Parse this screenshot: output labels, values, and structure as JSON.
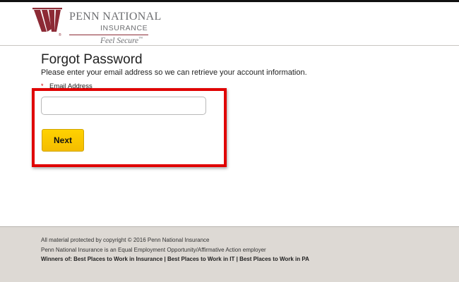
{
  "brand": {
    "name": "PENN NATIONAL",
    "sub": "INSURANCE",
    "tagline": "Feel Secure",
    "tagline_mark": "™",
    "registered_mark": "®",
    "accent_color": "#8c2a35"
  },
  "form": {
    "title": "Forgot Password",
    "instructions": "Please enter your email address so we can retrieve your account information.",
    "required_marker": "*",
    "email_label": "Email Address",
    "email_value": "",
    "email_placeholder": "",
    "next_label": "Next",
    "next_color": "#ffcc00"
  },
  "highlight_color": "#e00000",
  "footer": {
    "copyright": "All material protected by copyright © 2016 Penn National Insurance",
    "eeo": "Penn National Insurance is an Equal Employment Opportunity/Affirmative Action employer",
    "awards": "Winners of: Best Places to Work in Insurance | Best Places to Work in IT | Best Places to Work in PA"
  }
}
